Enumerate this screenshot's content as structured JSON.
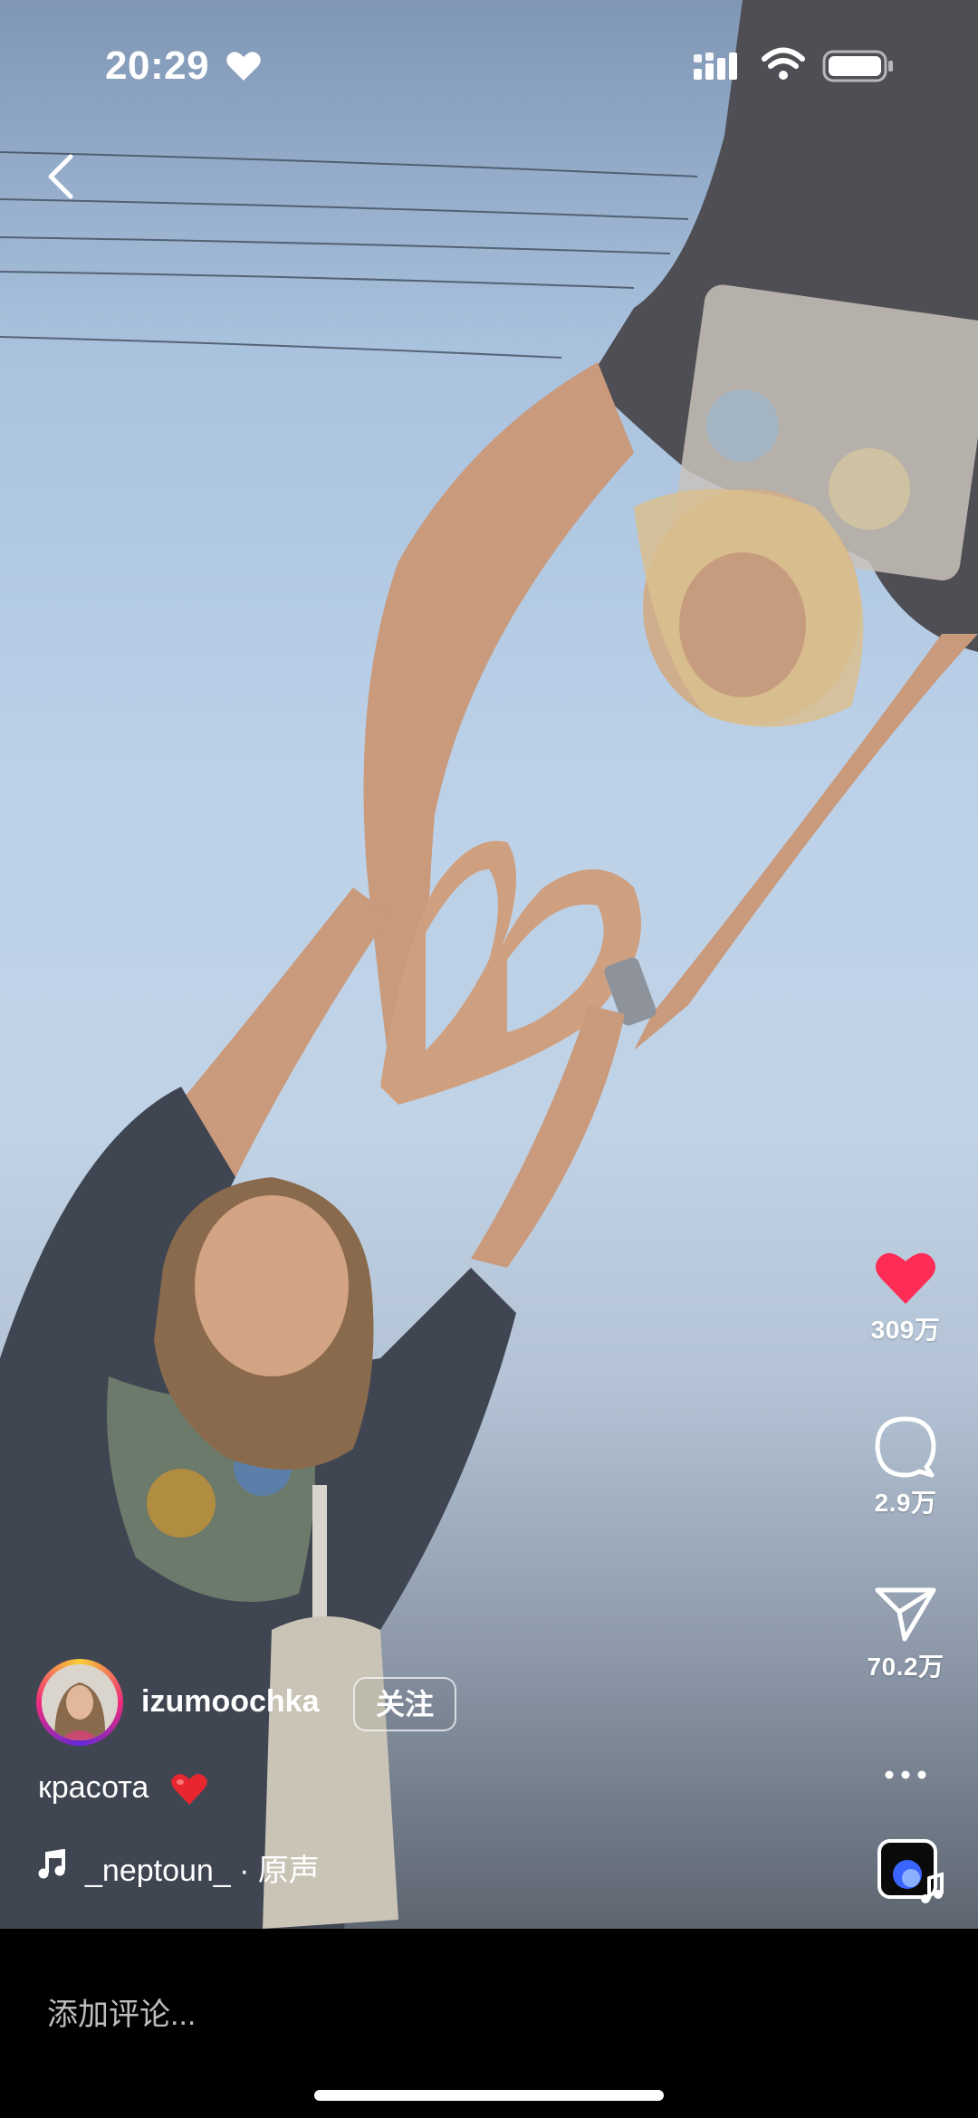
{
  "status_bar": {
    "time": "20:29",
    "time_icon": "heart-icon",
    "icons": [
      "cellular-signal-icon",
      "wifi-icon",
      "battery-icon"
    ]
  },
  "nav": {
    "back_icon": "chevron-left-icon"
  },
  "actions": {
    "like": {
      "icon": "heart-filled-icon",
      "count": "309万",
      "color": "#ff2d55"
    },
    "comment": {
      "icon": "comment-bubble-icon",
      "count": "2.9万"
    },
    "share": {
      "icon": "paper-plane-icon",
      "count": "70.2万"
    },
    "more": {
      "icon": "more-horizontal-icon"
    },
    "audio": {
      "icon": "audio-album-icon"
    }
  },
  "author": {
    "username": "izumoochka",
    "follow_label": "关注"
  },
  "caption": {
    "text": "красота",
    "emoji_icon": "red-heart-emoji"
  },
  "music": {
    "icon": "music-note-icon",
    "text": "_neptoun_ · 原声"
  },
  "comment": {
    "placeholder": "添加评论..."
  }
}
